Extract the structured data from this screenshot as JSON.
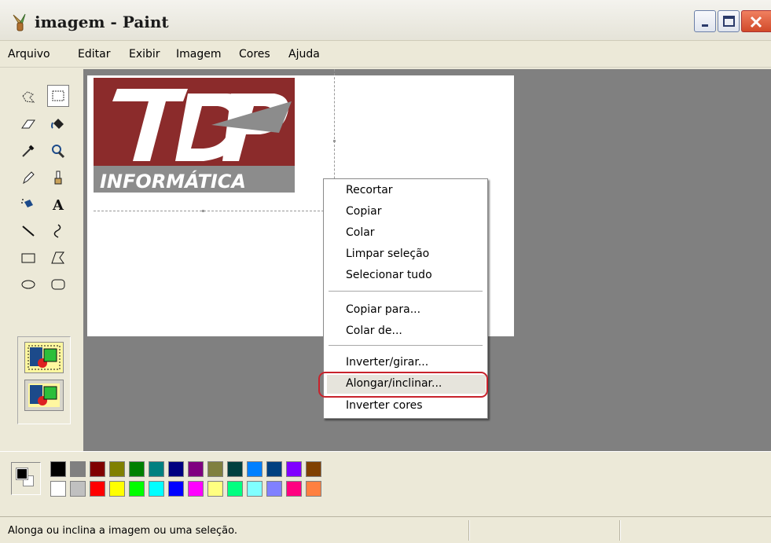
{
  "window": {
    "title": "imagem - Paint"
  },
  "menubar": {
    "items": [
      "Arquivo",
      "Editar",
      "Exibir",
      "Imagem",
      "Cores",
      "Ajuda"
    ]
  },
  "toolbox": {
    "tools": [
      "free-form-select-icon",
      "rectangle-select-icon",
      "eraser-icon",
      "fill-bucket-icon",
      "color-picker-icon",
      "magnifier-icon",
      "pencil-icon",
      "brush-icon",
      "airbrush-icon",
      "text-icon",
      "line-icon",
      "curve-icon",
      "rectangle-icon",
      "polygon-icon",
      "ellipse-icon",
      "rounded-rectangle-icon"
    ],
    "selected": "rectangle-select-icon"
  },
  "canvas": {
    "logo_text_top": "TDP",
    "logo_text_bottom": "INFORMÁTICA",
    "logo_colors": {
      "maroon": "#8b2b2b",
      "gray": "#8c8c8c",
      "white": "#ffffff"
    }
  },
  "context_menu": {
    "groups": [
      [
        "Recortar",
        "Copiar",
        "Colar",
        "Limpar seleção",
        "Selecionar tudo"
      ],
      [
        "Copiar para...",
        "Colar de..."
      ],
      [
        "Inverter/girar...",
        "Alongar/inclinar...",
        "Inverter cores"
      ]
    ],
    "highlighted": "Alongar/inclinar...",
    "highlight_ring_color": "#c8232c"
  },
  "palette": {
    "top": [
      "#000000",
      "#808080",
      "#800000",
      "#808000",
      "#008000",
      "#008080",
      "#000080",
      "#800080",
      "#808040",
      "#004040",
      "#0080ff",
      "#004080",
      "#8000ff",
      "#804000"
    ],
    "bottom": [
      "#ffffff",
      "#c0c0c0",
      "#ff0000",
      "#ffff00",
      "#00ff00",
      "#00ffff",
      "#0000ff",
      "#ff00ff",
      "#ffff80",
      "#00ff80",
      "#80ffff",
      "#8080ff",
      "#ff0080",
      "#ff8040"
    ],
    "foreground": "#000000",
    "background": "#ffffff"
  },
  "statusbar": {
    "text": "Alonga ou inclina a imagem ou uma seleção."
  }
}
